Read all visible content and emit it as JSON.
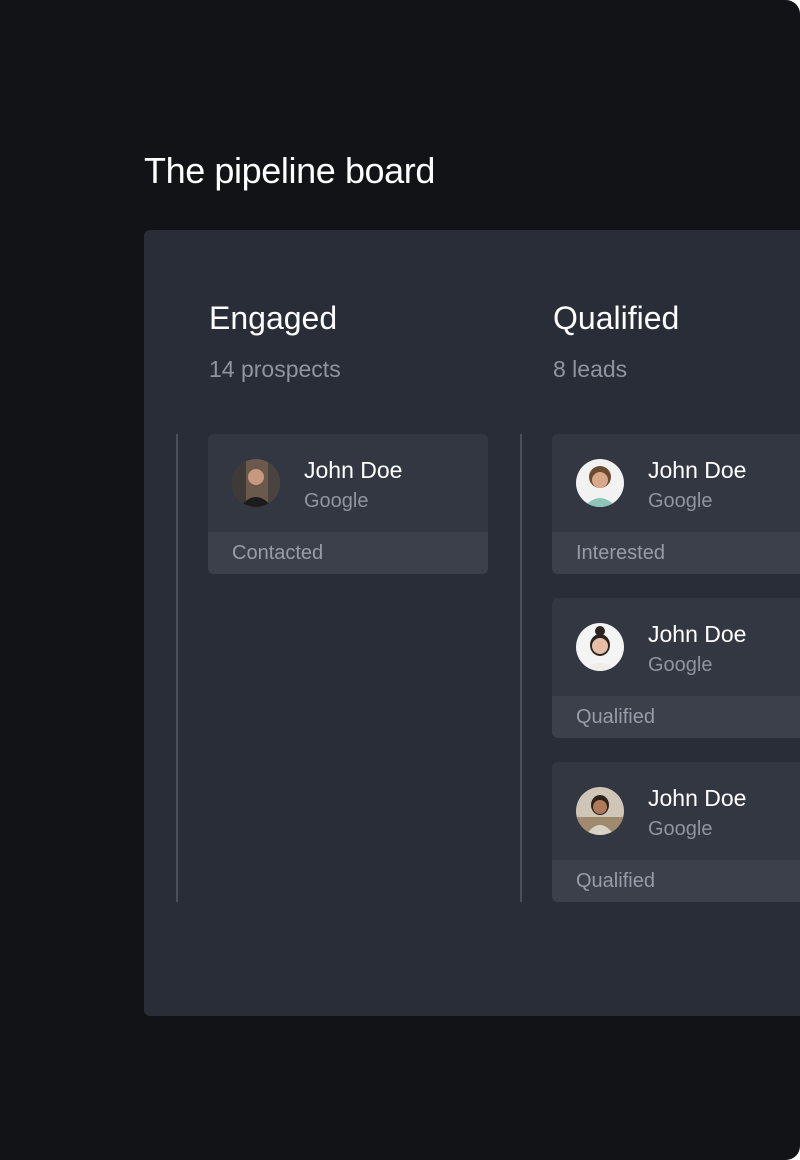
{
  "page": {
    "title": "The pipeline board"
  },
  "board": {
    "columns": [
      {
        "title": "Engaged",
        "count": "14 prospects",
        "cards": [
          {
            "name": "John Doe",
            "company": "Google",
            "status": "Contacted",
            "avatar": "avatar-man-dark-shirt-icon"
          }
        ]
      },
      {
        "title": "Qualified",
        "count": "8 leads",
        "cards": [
          {
            "name": "John Doe",
            "company": "Google",
            "status": "Interested",
            "avatar": "avatar-man-curly-hair-icon"
          },
          {
            "name": "John Doe",
            "company": "Google",
            "status": "Qualified",
            "avatar": "avatar-woman-smiling-icon"
          },
          {
            "name": "John Doe",
            "company": "Google",
            "status": "Qualified",
            "avatar": "avatar-woman-desk-icon"
          }
        ]
      }
    ]
  },
  "colors": {
    "background": "#121317",
    "board": "#292d38",
    "card": "#333742",
    "card_status": "#3c404b",
    "text_primary": "#ffffff",
    "text_secondary": "#8f94a1"
  }
}
